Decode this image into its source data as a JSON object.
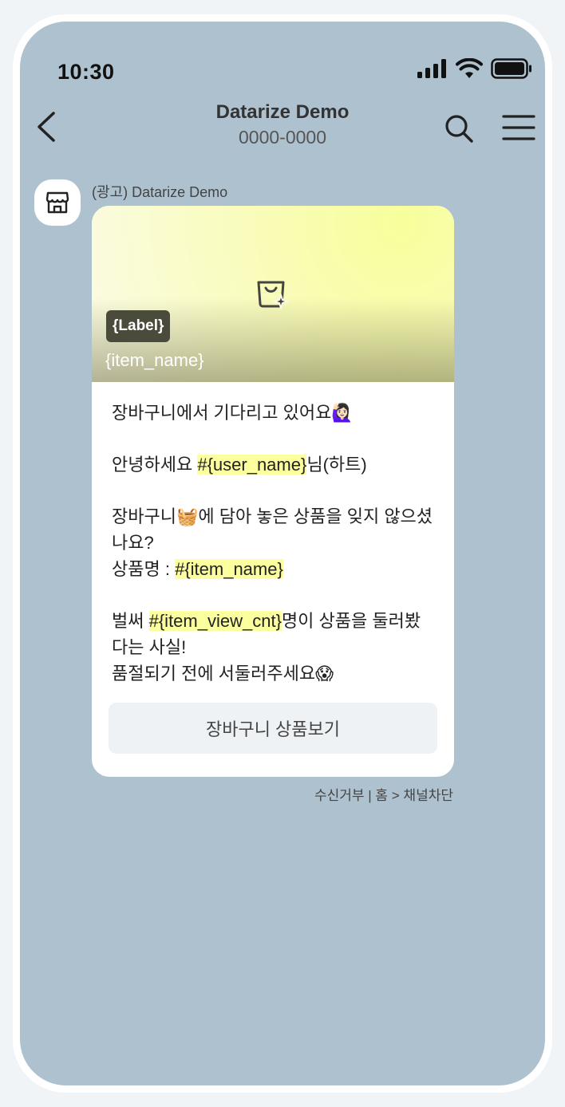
{
  "status_bar": {
    "time": "10:30"
  },
  "header": {
    "title": "Datarize Demo",
    "subtitle": "0000-0000"
  },
  "message": {
    "sender": "(광고) Datarize Demo",
    "hero": {
      "label": "{Label}",
      "item_name": "{item_name}"
    },
    "body": {
      "line1": "장바구니에서 기다리고 있어요🙋🏻‍♀️",
      "line2_pre": "안녕하세요 ",
      "line2_var": "#{user_name}",
      "line2_post": "님(하트)",
      "line3": "장바구니🧺에 담아 놓은 상품을 잊지 않으셨나요?",
      "line4_pre": "상품명 : ",
      "line4_var": "#{item_name}",
      "line5_pre": "벌써 ",
      "line5_var": "#{item_view_cnt}",
      "line5_post": "명이 상품을 둘러봤다는 사실!",
      "line6": "품절되기 전에 서둘러주세요😱"
    },
    "button_label": "장바구니 상품보기"
  },
  "footer": {
    "unsubscribe": "수신거부",
    "separator": " | ",
    "home_path": "홈 > 채널차단"
  },
  "colors": {
    "chat_background": "#adc1cf",
    "highlight": "#fbff9e",
    "label_bg": "#4b4b3b"
  }
}
